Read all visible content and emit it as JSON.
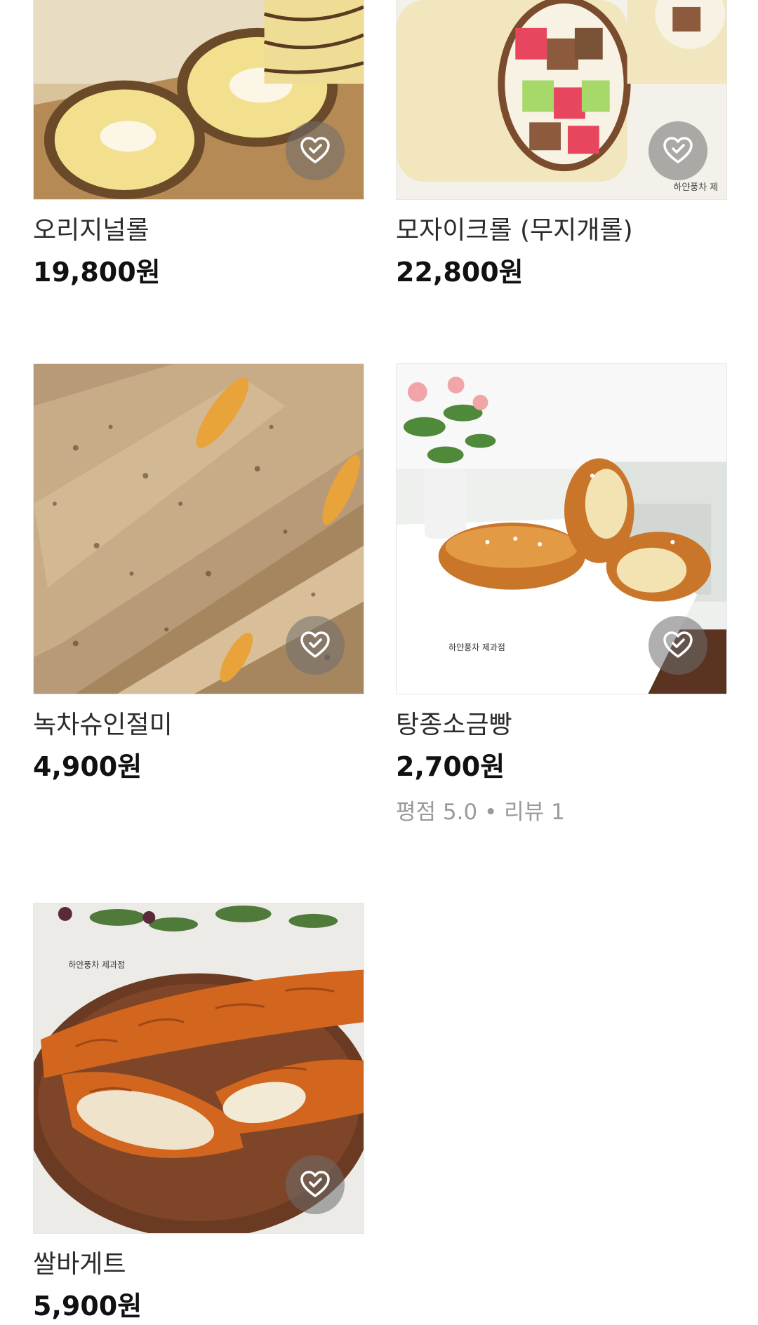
{
  "products": [
    {
      "name": "오리지널롤",
      "price": "19,800원",
      "image_icon": "roll-cake-image"
    },
    {
      "name": "모자이크롤 (무지개롤)",
      "price": "22,800원",
      "image_icon": "mosaic-roll-image"
    },
    {
      "name": "녹차슈인절미",
      "price": "4,900원",
      "image_icon": "injeolmi-bread-image"
    },
    {
      "name": "탕종소금빵",
      "price": "2,700원",
      "rating_text": "평점 5.0 • 리뷰 1",
      "image_icon": "salt-bread-image"
    },
    {
      "name": "쌀바게트",
      "price": "5,900원",
      "image_icon": "rice-baguette-image"
    }
  ],
  "wishlist_icon": "heart-check-icon",
  "colors": {
    "price": "#111111",
    "name": "#2b2b2b",
    "meta": "#9a9a9a",
    "wish_button_bg": "#6e6e6e"
  }
}
